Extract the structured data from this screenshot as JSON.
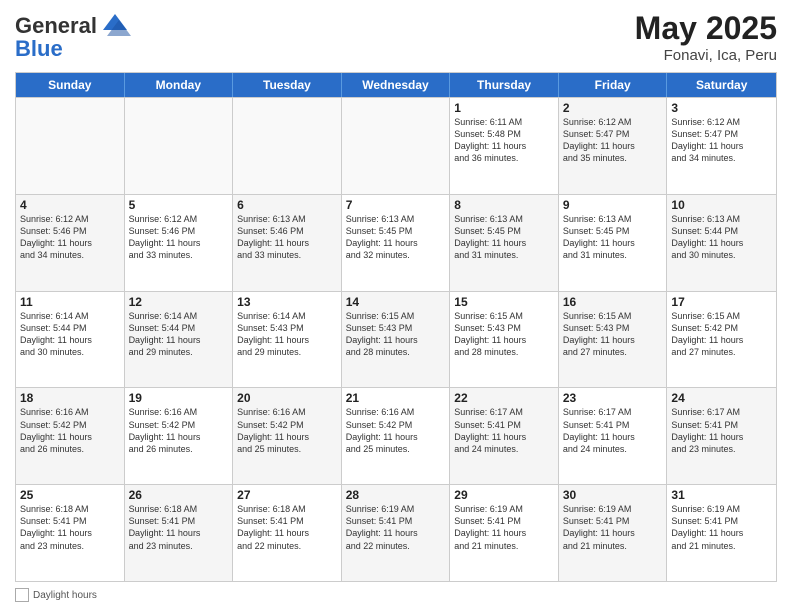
{
  "header": {
    "logo_general": "General",
    "logo_blue": "Blue",
    "title": "May 2025",
    "location": "Fonavi, Ica, Peru"
  },
  "weekdays": [
    "Sunday",
    "Monday",
    "Tuesday",
    "Wednesday",
    "Thursday",
    "Friday",
    "Saturday"
  ],
  "rows": [
    [
      {
        "day": "",
        "info": "",
        "empty": true
      },
      {
        "day": "",
        "info": "",
        "empty": true
      },
      {
        "day": "",
        "info": "",
        "empty": true
      },
      {
        "day": "",
        "info": "",
        "empty": true
      },
      {
        "day": "1",
        "info": "Sunrise: 6:11 AM\nSunset: 5:48 PM\nDaylight: 11 hours\nand 36 minutes."
      },
      {
        "day": "2",
        "info": "Sunrise: 6:12 AM\nSunset: 5:47 PM\nDaylight: 11 hours\nand 35 minutes."
      },
      {
        "day": "3",
        "info": "Sunrise: 6:12 AM\nSunset: 5:47 PM\nDaylight: 11 hours\nand 34 minutes."
      }
    ],
    [
      {
        "day": "4",
        "info": "Sunrise: 6:12 AM\nSunset: 5:46 PM\nDaylight: 11 hours\nand 34 minutes."
      },
      {
        "day": "5",
        "info": "Sunrise: 6:12 AM\nSunset: 5:46 PM\nDaylight: 11 hours\nand 33 minutes."
      },
      {
        "day": "6",
        "info": "Sunrise: 6:13 AM\nSunset: 5:46 PM\nDaylight: 11 hours\nand 33 minutes."
      },
      {
        "day": "7",
        "info": "Sunrise: 6:13 AM\nSunset: 5:45 PM\nDaylight: 11 hours\nand 32 minutes."
      },
      {
        "day": "8",
        "info": "Sunrise: 6:13 AM\nSunset: 5:45 PM\nDaylight: 11 hours\nand 31 minutes."
      },
      {
        "day": "9",
        "info": "Sunrise: 6:13 AM\nSunset: 5:45 PM\nDaylight: 11 hours\nand 31 minutes."
      },
      {
        "day": "10",
        "info": "Sunrise: 6:13 AM\nSunset: 5:44 PM\nDaylight: 11 hours\nand 30 minutes."
      }
    ],
    [
      {
        "day": "11",
        "info": "Sunrise: 6:14 AM\nSunset: 5:44 PM\nDaylight: 11 hours\nand 30 minutes."
      },
      {
        "day": "12",
        "info": "Sunrise: 6:14 AM\nSunset: 5:44 PM\nDaylight: 11 hours\nand 29 minutes."
      },
      {
        "day": "13",
        "info": "Sunrise: 6:14 AM\nSunset: 5:43 PM\nDaylight: 11 hours\nand 29 minutes."
      },
      {
        "day": "14",
        "info": "Sunrise: 6:15 AM\nSunset: 5:43 PM\nDaylight: 11 hours\nand 28 minutes."
      },
      {
        "day": "15",
        "info": "Sunrise: 6:15 AM\nSunset: 5:43 PM\nDaylight: 11 hours\nand 28 minutes."
      },
      {
        "day": "16",
        "info": "Sunrise: 6:15 AM\nSunset: 5:43 PM\nDaylight: 11 hours\nand 27 minutes."
      },
      {
        "day": "17",
        "info": "Sunrise: 6:15 AM\nSunset: 5:42 PM\nDaylight: 11 hours\nand 27 minutes."
      }
    ],
    [
      {
        "day": "18",
        "info": "Sunrise: 6:16 AM\nSunset: 5:42 PM\nDaylight: 11 hours\nand 26 minutes."
      },
      {
        "day": "19",
        "info": "Sunrise: 6:16 AM\nSunset: 5:42 PM\nDaylight: 11 hours\nand 26 minutes."
      },
      {
        "day": "20",
        "info": "Sunrise: 6:16 AM\nSunset: 5:42 PM\nDaylight: 11 hours\nand 25 minutes."
      },
      {
        "day": "21",
        "info": "Sunrise: 6:16 AM\nSunset: 5:42 PM\nDaylight: 11 hours\nand 25 minutes."
      },
      {
        "day": "22",
        "info": "Sunrise: 6:17 AM\nSunset: 5:41 PM\nDaylight: 11 hours\nand 24 minutes."
      },
      {
        "day": "23",
        "info": "Sunrise: 6:17 AM\nSunset: 5:41 PM\nDaylight: 11 hours\nand 24 minutes."
      },
      {
        "day": "24",
        "info": "Sunrise: 6:17 AM\nSunset: 5:41 PM\nDaylight: 11 hours\nand 23 minutes."
      }
    ],
    [
      {
        "day": "25",
        "info": "Sunrise: 6:18 AM\nSunset: 5:41 PM\nDaylight: 11 hours\nand 23 minutes."
      },
      {
        "day": "26",
        "info": "Sunrise: 6:18 AM\nSunset: 5:41 PM\nDaylight: 11 hours\nand 23 minutes."
      },
      {
        "day": "27",
        "info": "Sunrise: 6:18 AM\nSunset: 5:41 PM\nDaylight: 11 hours\nand 22 minutes."
      },
      {
        "day": "28",
        "info": "Sunrise: 6:19 AM\nSunset: 5:41 PM\nDaylight: 11 hours\nand 22 minutes."
      },
      {
        "day": "29",
        "info": "Sunrise: 6:19 AM\nSunset: 5:41 PM\nDaylight: 11 hours\nand 21 minutes."
      },
      {
        "day": "30",
        "info": "Sunrise: 6:19 AM\nSunset: 5:41 PM\nDaylight: 11 hours\nand 21 minutes."
      },
      {
        "day": "31",
        "info": "Sunrise: 6:19 AM\nSunset: 5:41 PM\nDaylight: 11 hours\nand 21 minutes."
      }
    ]
  ],
  "legend": {
    "daylight_label": "Daylight hours"
  }
}
